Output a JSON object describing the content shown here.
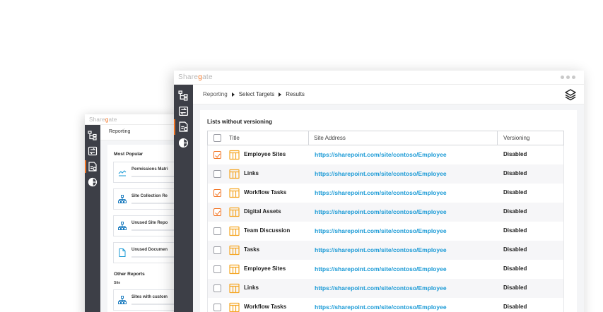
{
  "brand": {
    "name_pre": "Share",
    "name_g": "g",
    "name_post": "ate"
  },
  "back_window": {
    "breadcrumb": "Reporting",
    "most_popular_heading": "Most Popular",
    "popular_items": [
      {
        "label": "Permissions Matri",
        "icon": "permissions-icon"
      },
      {
        "label": "Site Collection Re",
        "icon": "site-hierarchy-icon"
      },
      {
        "label": "Unused Site Repo",
        "icon": "site-hierarchy-icon"
      },
      {
        "label": "Unused Documen",
        "icon": "document-icon"
      }
    ],
    "other_reports_heading": "Other Reports",
    "site_subheading": "Site",
    "other_items": [
      {
        "label": "Sites with custom",
        "icon": "site-hierarchy-icon"
      }
    ]
  },
  "front_window": {
    "breadcrumb": [
      "Reporting",
      "Select Targets",
      "Results"
    ],
    "card_title": "Lists without versioning",
    "columns": {
      "title": "Title",
      "site_address": "Site Address",
      "versioning": "Versioning"
    },
    "rows": [
      {
        "checked": true,
        "title": "Employee Sites",
        "url": "https://sharepoint.com/site/contoso/Employee",
        "versioning": "Disabled"
      },
      {
        "checked": false,
        "title": "Links",
        "url": "https://sharepoint.com/site/contoso/Employee",
        "versioning": "Disabled"
      },
      {
        "checked": true,
        "title": "Workflow Tasks",
        "url": "https://sharepoint.com/site/contoso/Employee",
        "versioning": "Disabled"
      },
      {
        "checked": true,
        "title": "Digital Assets",
        "url": "https://sharepoint.com/site/contoso/Employee",
        "versioning": "Disabled"
      },
      {
        "checked": false,
        "title": "Team Discussion",
        "url": "https://sharepoint.com/site/contoso/Employee",
        "versioning": "Disabled"
      },
      {
        "checked": false,
        "title": "Tasks",
        "url": "https://sharepoint.com/site/contoso/Employee",
        "versioning": "Disabled"
      },
      {
        "checked": false,
        "title": "Employee Sites",
        "url": "https://sharepoint.com/site/contoso/Employee",
        "versioning": "Disabled"
      },
      {
        "checked": false,
        "title": "Links",
        "url": "https://sharepoint.com/site/contoso/Employee",
        "versioning": "Disabled"
      },
      {
        "checked": false,
        "title": "Workflow Tasks",
        "url": "https://sharepoint.com/site/contoso/Employee",
        "versioning": "Disabled"
      }
    ]
  },
  "rail_icons": [
    "site-tree-icon",
    "migration-icon",
    "reporting-icon",
    "explorer-icon"
  ],
  "colors": {
    "accent": "#f37321",
    "link": "#1a9ad6",
    "rail": "#3d3f47",
    "panel_bg": "#f4f5f7"
  }
}
